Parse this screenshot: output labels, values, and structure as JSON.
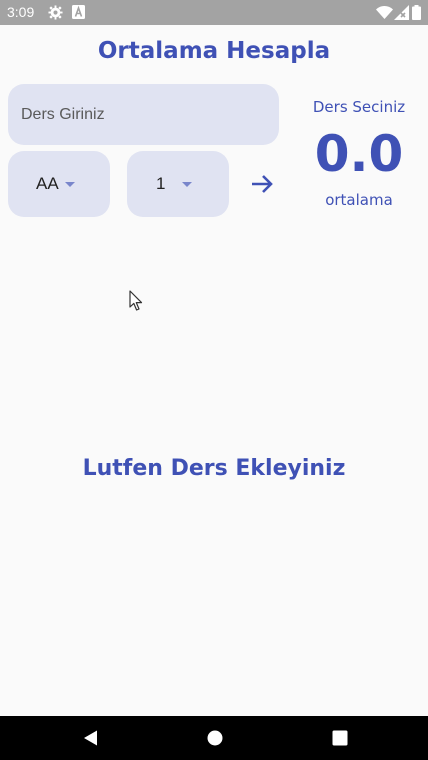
{
  "status_bar": {
    "time": "3:09",
    "icons": [
      "settings-icon",
      "font-icon",
      "wifi-icon",
      "signal-icon",
      "battery-icon"
    ]
  },
  "app": {
    "title": "Ortalama Hesapla"
  },
  "form": {
    "course_placeholder": "Ders Giriniz",
    "grade_selected": "AA",
    "credit_selected": "1",
    "add_icon": "arrow-right-icon"
  },
  "summary": {
    "label": "Ders Seciniz",
    "average": "0.0",
    "caption": "ortalama"
  },
  "list": {
    "empty_message": "Lutfen Ders Ekleyiniz"
  },
  "nav_bar": {
    "buttons": [
      "back-icon",
      "home-icon",
      "recents-icon"
    ]
  },
  "colors": {
    "primary": "#3f51b5",
    "field_background": "#e0e3f2",
    "background": "#fafafa",
    "status_bar": "#a3a3a3",
    "nav_bar": "#000000"
  }
}
